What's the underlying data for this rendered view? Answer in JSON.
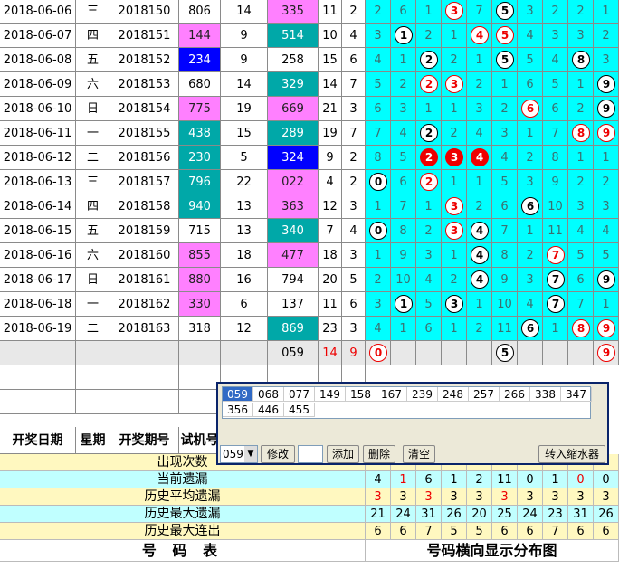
{
  "rows": [
    {
      "date": "2018-06-06",
      "week": "三",
      "issue": "2018150",
      "test": "806",
      "s1": "14",
      "open": "335",
      "a": "11",
      "b": "2",
      "dist": [
        "2",
        "6",
        "1",
        "3",
        "7",
        "5",
        "3",
        "2",
        "2",
        "1"
      ]
    },
    {
      "date": "2018-06-07",
      "week": "四",
      "issue": "2018151",
      "test": "144",
      "s1": "9",
      "open": "514",
      "a": "10",
      "b": "4",
      "dist": [
        "3",
        "1",
        "2",
        "1",
        "4",
        "5",
        "4",
        "3",
        "3",
        "2"
      ]
    },
    {
      "date": "2018-06-08",
      "week": "五",
      "issue": "2018152",
      "test": "234",
      "s1": "9",
      "open": "258",
      "a": "15",
      "b": "6",
      "dist": [
        "4",
        "1",
        "2",
        "2",
        "1",
        "5",
        "5",
        "4",
        "8",
        "3"
      ]
    },
    {
      "date": "2018-06-09",
      "week": "六",
      "issue": "2018153",
      "test": "680",
      "s1": "14",
      "open": "329",
      "a": "14",
      "b": "7",
      "dist": [
        "5",
        "2",
        "2",
        "3",
        "2",
        "1",
        "6",
        "5",
        "1",
        "9"
      ]
    },
    {
      "date": "2018-06-10",
      "week": "日",
      "issue": "2018154",
      "test": "775",
      "s1": "19",
      "open": "669",
      "a": "21",
      "b": "3",
      "dist": [
        "6",
        "3",
        "1",
        "1",
        "3",
        "2",
        "6",
        "6",
        "2",
        "9"
      ]
    },
    {
      "date": "2018-06-11",
      "week": "一",
      "issue": "2018155",
      "test": "438",
      "s1": "15",
      "open": "289",
      "a": "19",
      "b": "7",
      "dist": [
        "7",
        "4",
        "2",
        "2",
        "4",
        "3",
        "1",
        "7",
        "8",
        "9"
      ]
    },
    {
      "date": "2018-06-12",
      "week": "二",
      "issue": "2018156",
      "test": "230",
      "s1": "5",
      "open": "324",
      "a": "9",
      "b": "2",
      "dist": [
        "8",
        "5",
        "2",
        "3",
        "4",
        "4",
        "2",
        "8",
        "1",
        "1"
      ]
    },
    {
      "date": "2018-06-13",
      "week": "三",
      "issue": "2018157",
      "test": "796",
      "s1": "22",
      "open": "022",
      "a": "4",
      "b": "2",
      "dist": [
        "0",
        "6",
        "2",
        "1",
        "1",
        "5",
        "3",
        "9",
        "2",
        "2"
      ]
    },
    {
      "date": "2018-06-14",
      "week": "四",
      "issue": "2018158",
      "test": "940",
      "s1": "13",
      "open": "363",
      "a": "12",
      "b": "3",
      "dist": [
        "1",
        "7",
        "1",
        "3",
        "2",
        "6",
        "6",
        "10",
        "3",
        "3"
      ]
    },
    {
      "date": "2018-06-15",
      "week": "五",
      "issue": "2018159",
      "test": "715",
      "s1": "13",
      "open": "340",
      "a": "7",
      "b": "4",
      "dist": [
        "0",
        "8",
        "2",
        "3",
        "4",
        "7",
        "1",
        "11",
        "4",
        "4"
      ]
    },
    {
      "date": "2018-06-16",
      "week": "六",
      "issue": "2018160",
      "test": "855",
      "s1": "18",
      "open": "477",
      "a": "18",
      "b": "3",
      "dist": [
        "1",
        "9",
        "3",
        "1",
        "4",
        "8",
        "2",
        "7",
        "5",
        "5"
      ]
    },
    {
      "date": "2018-06-17",
      "week": "日",
      "issue": "2018161",
      "test": "880",
      "s1": "16",
      "open": "794",
      "a": "20",
      "b": "5",
      "dist": [
        "2",
        "10",
        "4",
        "2",
        "4",
        "9",
        "3",
        "7",
        "6",
        "9"
      ]
    },
    {
      "date": "2018-06-18",
      "week": "一",
      "issue": "2018162",
      "test": "330",
      "s1": "6",
      "open": "137",
      "a": "11",
      "b": "6",
      "dist": [
        "3",
        "1",
        "5",
        "3",
        "1",
        "10",
        "4",
        "7",
        "7",
        "1"
      ]
    },
    {
      "date": "2018-06-19",
      "week": "二",
      "issue": "2018163",
      "test": "318",
      "s1": "12",
      "open": "869",
      "a": "23",
      "b": "3",
      "dist": [
        "4",
        "1",
        "6",
        "1",
        "2",
        "11",
        "6",
        "1",
        "8",
        "9"
      ]
    }
  ],
  "pending": {
    "open": "059",
    "a": "14",
    "b": "9",
    "dist": [
      "0",
      "",
      "",
      "",
      "",
      "5",
      "",
      "",
      "",
      "9"
    ]
  },
  "popup": {
    "numbers": [
      "059",
      "068",
      "077",
      "149",
      "158",
      "167",
      "239",
      "248",
      "257",
      "266",
      "338",
      "347",
      "356",
      "446",
      "455"
    ],
    "select_value": "059",
    "btn_modify": "修改",
    "btn_add": "添加",
    "btn_delete": "删除",
    "btn_clear": "清空",
    "btn_import": "转入缩水器"
  },
  "header": {
    "date": "开奖日期",
    "week": "星期",
    "issue": "开奖期号",
    "test": "试机号"
  },
  "stats": [
    {
      "label": "出现次数",
      "values": [
        "",
        "",
        "",
        "",
        "",
        "",
        "",
        "",
        "",
        ""
      ]
    },
    {
      "label": "当前遗漏",
      "values": [
        "4",
        "1",
        "6",
        "1",
        "2",
        "11",
        "0",
        "1",
        "0",
        "0"
      ]
    },
    {
      "label": "历史平均遗漏",
      "values": [
        "3",
        "3",
        "3",
        "3",
        "3",
        "3",
        "3",
        "3",
        "3",
        "3"
      ]
    },
    {
      "label": "历史最大遗漏",
      "values": [
        "21",
        "24",
        "31",
        "26",
        "20",
        "25",
        "24",
        "23",
        "31",
        "26"
      ]
    },
    {
      "label": "历史最大连出",
      "values": [
        "6",
        "6",
        "7",
        "5",
        "5",
        "6",
        "6",
        "7",
        "6",
        "6"
      ]
    }
  ],
  "footer": {
    "left": "号 码 表",
    "right": "号码横向显示分布图"
  }
}
